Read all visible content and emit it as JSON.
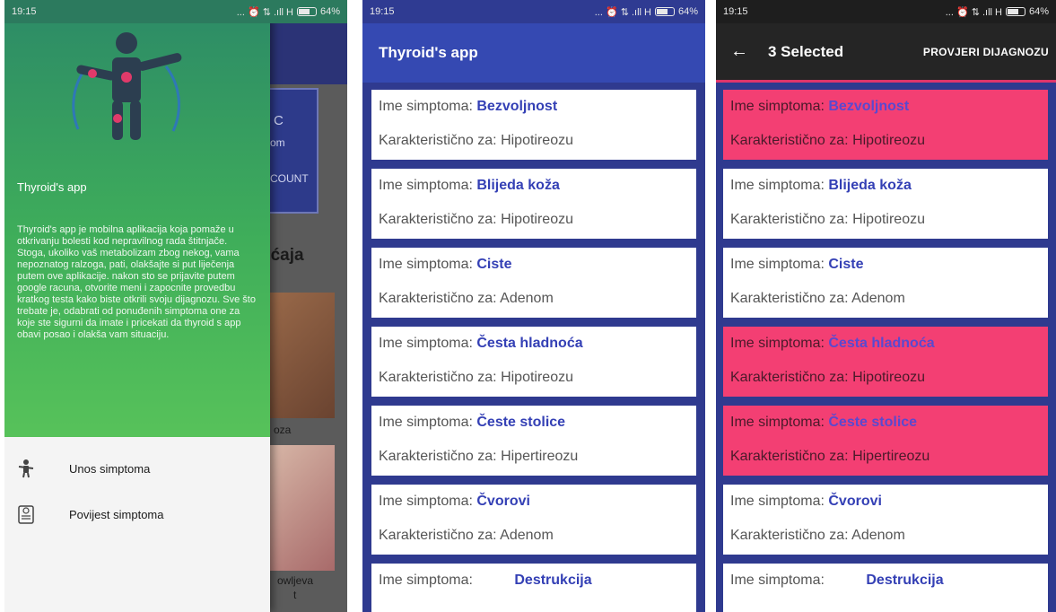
{
  "status_bar": {
    "time": "19:15",
    "icons": "... ⏰ ⇅ .ıll H",
    "battery": "64%"
  },
  "screen1": {
    "bg_card_lines": [
      "C",
      "om",
      "COUNT"
    ],
    "bg_heading": "ećaja",
    "bg_label1": "oza",
    "bg_label2": "owljeva",
    "bg_label3": "t",
    "drawer": {
      "title": "Thyroid's app",
      "description": "Thyroid's app je mobilna aplikacija koja pomaže u otkrivanju bolesti kod nepravilnog rada štitnjače. Stoga, ukoliko vaš metabolizam zbog nekog, vama nepoznatog ralzoga, pati, olakšajte si put liječenja putem ove aplikacije. nakon sto se prijavite putem google racuna, otvorite meni i zapocnite provedbu kratkog testa kako biste otkrili svoju dijagnozu. Sve što trebate je, odabrati od ponuđenih simptoma one za koje ste sigurni da imate i pricekati da thyroid s app obavi posao i olakša vam situaciju.",
      "menu": [
        {
          "label": "Unos simptoma",
          "icon": "person-symptom-icon"
        },
        {
          "label": "Povijest simptoma",
          "icon": "clipboard-icon"
        }
      ]
    }
  },
  "screen2": {
    "title": "Thyroid's app"
  },
  "screen3": {
    "selected_label": "3 Selected",
    "action_label": "PROVJERI DIJAGNOZU"
  },
  "labels": {
    "symptom": "Ime simptoma: ",
    "characteristic": "Karakteristično za: "
  },
  "symptoms": [
    {
      "name": "Bezvoljnost",
      "for": "Hipotireozu",
      "selected": true
    },
    {
      "name": "Blijeda koža",
      "for": "Hipotireozu",
      "selected": false
    },
    {
      "name": "Ciste",
      "for": "Adenom",
      "selected": false
    },
    {
      "name": "Česta hladnoća",
      "for": "Hipotireozu",
      "selected": true
    },
    {
      "name": "Česte stolice",
      "for": "Hipertireozu",
      "selected": true
    },
    {
      "name": "Čvorovi",
      "for": "Adenom",
      "selected": false
    },
    {
      "name": "Destrukcija",
      "for": "",
      "selected": false
    }
  ],
  "colors": {
    "accent_blue": "#3549b2",
    "selected_pink": "#f33f73",
    "drawer_green": "#3fae5a"
  }
}
